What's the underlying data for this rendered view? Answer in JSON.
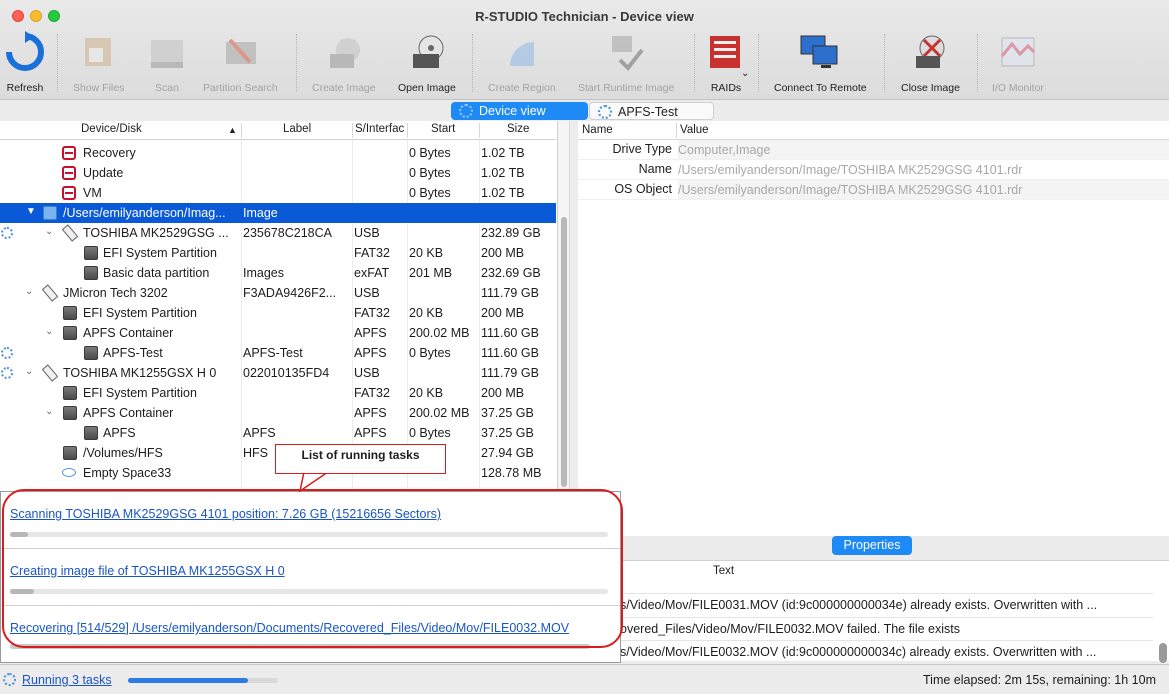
{
  "window": {
    "title": "R-STUDIO Technician - Device view"
  },
  "toolbar": {
    "items": [
      {
        "label": "Refresh",
        "icon": "refresh-icon",
        "enabled": true
      },
      {
        "label": "Show Files",
        "icon": "show-files-icon",
        "enabled": false
      },
      {
        "label": "Scan",
        "icon": "scan-icon",
        "enabled": false
      },
      {
        "label": "Partition Search",
        "icon": "partition-search-icon",
        "enabled": false
      },
      {
        "label": "Create Image",
        "icon": "create-image-icon",
        "enabled": false
      },
      {
        "label": "Open Image",
        "icon": "open-image-icon",
        "enabled": true
      },
      {
        "label": "Create Region",
        "icon": "create-region-icon",
        "enabled": false
      },
      {
        "label": "Start Runtime Image",
        "icon": "runtime-image-icon",
        "enabled": false
      },
      {
        "label": "RAIDs",
        "icon": "raids-icon",
        "enabled": true
      },
      {
        "label": "Connect To Remote",
        "icon": "connect-remote-icon",
        "enabled": true
      },
      {
        "label": "Close Image",
        "icon": "close-image-icon",
        "enabled": true
      },
      {
        "label": "I/O Monitor",
        "icon": "io-monitor-icon",
        "enabled": false
      }
    ]
  },
  "tabs": [
    {
      "label": "Device view",
      "active": true
    },
    {
      "label": "APFS-Test",
      "active": false
    }
  ],
  "tree": {
    "columns": [
      "Device/Disk",
      "Label",
      "S/Interfac",
      "Start",
      "Size"
    ],
    "rows": [
      {
        "name": "Recovery",
        "label": "",
        "iface": "",
        "start": "0 Bytes",
        "size": "1.02 TB"
      },
      {
        "name": "Update",
        "label": "",
        "iface": "",
        "start": "0 Bytes",
        "size": "1.02 TB"
      },
      {
        "name": "VM",
        "label": "",
        "iface": "",
        "start": "0 Bytes",
        "size": "1.02 TB"
      },
      {
        "name": "/Users/emilyanderson/Imag...",
        "label": "Image",
        "iface": "",
        "start": "",
        "size": ""
      },
      {
        "name": "TOSHIBA MK2529GSG ...",
        "label": "235678C218CA",
        "iface": "USB",
        "start": "",
        "size": "232.89 GB"
      },
      {
        "name": "EFI System Partition",
        "label": "",
        "iface": "FAT32",
        "start": "20 KB",
        "size": "200 MB"
      },
      {
        "name": "Basic data partition",
        "label": "Images",
        "iface": "exFAT",
        "start": "201 MB",
        "size": "232.69 GB"
      },
      {
        "name": "JMicron Tech 3202",
        "label": "F3ADA9426F2...",
        "iface": "USB",
        "start": "",
        "size": "111.79 GB"
      },
      {
        "name": "EFI System Partition",
        "label": "",
        "iface": "FAT32",
        "start": "20 KB",
        "size": "200 MB"
      },
      {
        "name": "APFS Container",
        "label": "",
        "iface": "APFS",
        "start": "200.02 MB",
        "size": "111.60 GB"
      },
      {
        "name": "APFS-Test",
        "label": "APFS-Test",
        "iface": "APFS",
        "start": "0 Bytes",
        "size": "111.60 GB"
      },
      {
        "name": "TOSHIBA MK1255GSX H 0",
        "label": "022010135FD4",
        "iface": "USB",
        "start": "",
        "size": "111.79 GB"
      },
      {
        "name": "EFI System Partition",
        "label": "",
        "iface": "FAT32",
        "start": "20 KB",
        "size": "200 MB"
      },
      {
        "name": "APFS Container",
        "label": "",
        "iface": "APFS",
        "start": "200.02 MB",
        "size": "37.25 GB"
      },
      {
        "name": "APFS",
        "label": "APFS",
        "iface": "APFS",
        "start": "0 Bytes",
        "size": "37.25 GB"
      },
      {
        "name": "/Volumes/HFS",
        "label": "HFS",
        "iface": "",
        "start": "",
        "size": "27.94 GB"
      },
      {
        "name": "Empty Space33",
        "label": "",
        "iface": "",
        "start": "",
        "size": "128.78 MB"
      }
    ]
  },
  "properties": {
    "columns": [
      "Name",
      "Value"
    ],
    "rows": [
      {
        "name": "Drive Type",
        "value": "Computer,Image"
      },
      {
        "name": "Name",
        "value": "/Users/emilyanderson/Image/TOSHIBA MK2529GSG 4101.rdr"
      },
      {
        "name": "OS Object",
        "value": "/Users/emilyanderson/Image/TOSHIBA MK2529GSG 4101.rdr"
      }
    ],
    "tab_label": "Properties"
  },
  "log": {
    "column": "Text",
    "lines": [
      "s/Video/Mov/FILE0031.MOV (id:9c000000000034e) already exists. Overwritten with ...",
      "overed_Files/Video/Mov/FILE0032.MOV failed. The file exists",
      "s/Video/Mov/FILE0032.MOV (id:9c000000000034c) already exists. Overwritten with ..."
    ]
  },
  "tasks": {
    "callout": "List of running tasks",
    "items": [
      {
        "text": "Scanning TOSHIBA MK2529GSG 4101 position: 7.26 GB (15216656 Sectors)",
        "progress": 0.03
      },
      {
        "text": "Creating image file of TOSHIBA MK1255GSX H 0",
        "progress": 0.04
      },
      {
        "text": "Recovering [514/529] /Users/emilyanderson/Documents/Recovered_Files/Video/Mov/FILE0032.MOV",
        "progress": 0.97
      }
    ]
  },
  "status": {
    "running": "Running 3 tasks",
    "progress": 0.8,
    "time": "Time elapsed: 2m 15s, remaining: 1h 10m"
  },
  "colors": {
    "accent": "#1e8af6",
    "selection": "#0a59d6",
    "callout": "#d91c1c",
    "link": "#1a55c4"
  }
}
